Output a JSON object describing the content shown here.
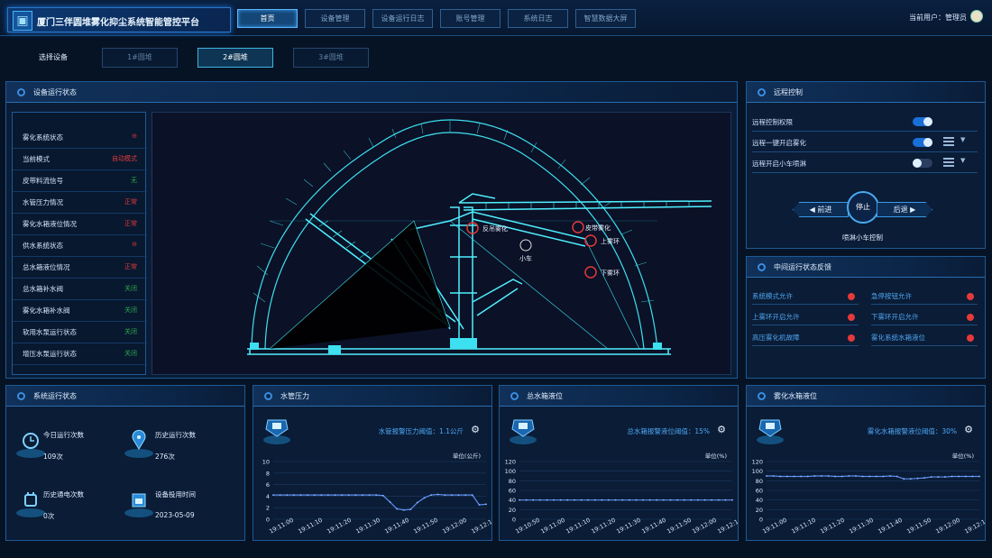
{
  "header": {
    "title": "厦门三伴圆堆雾化抑尘系统智能管控平台",
    "logo_icon": "cube-icon",
    "user_label": "当前用户：管理员",
    "nav": [
      {
        "label": "首页",
        "active": true
      },
      {
        "label": "设备管理"
      },
      {
        "label": "设备运行日志"
      },
      {
        "label": "账号管理"
      },
      {
        "label": "系统日志"
      },
      {
        "label": "智慧数据大屏"
      }
    ]
  },
  "device_select": {
    "label": "选择设备",
    "options": [
      {
        "label": "1#圆堆"
      },
      {
        "label": "2#圆堆",
        "active": true
      },
      {
        "label": "3#圆堆"
      }
    ]
  },
  "device_status": {
    "title": "设备运行状态",
    "rows": [
      {
        "label": "雾化系统状态",
        "value": "⊖",
        "color": "#e33a3a"
      },
      {
        "label": "当前模式",
        "value": "自动模式",
        "color": "#e33a3a"
      },
      {
        "label": "皮带料流信号",
        "value": "无",
        "color": "#2ea84e"
      },
      {
        "label": "水管压力情况",
        "value": "正常",
        "color": "#e33a3a"
      },
      {
        "label": "雾化水箱液位情况",
        "value": "正常",
        "color": "#e33a3a"
      },
      {
        "label": "供水系统状态",
        "value": "⊖",
        "color": "#e33a3a"
      },
      {
        "label": "总水箱液位情况",
        "value": "正常",
        "color": "#e33a3a"
      },
      {
        "label": "总水箱补水阀",
        "value": "关闭",
        "color": "#2ea84e"
      },
      {
        "label": "雾化水箱补水阀",
        "value": "关闭",
        "color": "#2ea84e"
      },
      {
        "label": "软用水泵运行状态",
        "value": "关闭",
        "color": "#2ea84e"
      },
      {
        "label": "增压水泵运行状态",
        "value": "关闭",
        "color": "#2ea84e"
      }
    ],
    "diagram_labels": {
      "left_spray": "反吊雾化",
      "right_spray": "皮带雾化",
      "upper_ring": "上雾环",
      "lower_ring": "下雾环",
      "cart": "小车"
    }
  },
  "remote_control": {
    "title": "远程控制",
    "rows": [
      {
        "label": "远程控制权限",
        "on": true
      },
      {
        "label": "远程一键开启雾化",
        "on": true,
        "menu": true
      },
      {
        "label": "远程开启小车喷淋",
        "on": false,
        "menu": true
      }
    ],
    "forward_label": "前进",
    "stop_label": "停止",
    "back_label": "后退",
    "caption": "喷淋小车控制"
  },
  "feedback": {
    "title": "中间运行状态反馈",
    "items": [
      {
        "label": "系统模式允许"
      },
      {
        "label": "急停按钮允许"
      },
      {
        "label": "上雾环开启允许"
      },
      {
        "label": "下雾环开启允许"
      },
      {
        "label": "高压雾化机故障"
      },
      {
        "label": "雾化系统水箱液位"
      }
    ],
    "dot_color": "#e5393a"
  },
  "system_stats": {
    "title": "系统运行状态",
    "items": [
      {
        "label": "今日运行次数",
        "value": "109次",
        "icon": "clock-icon"
      },
      {
        "label": "历史运行次数",
        "value": "276次",
        "icon": "location-pin-icon"
      },
      {
        "label": "历史通电次数",
        "value": "0次",
        "icon": "power-plug-icon"
      },
      {
        "label": "设备投用时间",
        "value": "2023-05-09",
        "icon": "calendar-icon"
      }
    ]
  },
  "charts": [
    {
      "title": "水管压力",
      "threshold": "水管报警压力阈值：1.1公斤",
      "unit": "单位(公斤)",
      "chart_data": {
        "type": "line",
        "x": [
          "19:11:00",
          "19:11:10",
          "19:11:20",
          "19:11:30",
          "19:11:40",
          "19:11:50",
          "19:12:00",
          "19:12:10"
        ],
        "ylim": [
          0,
          10
        ],
        "yticks": [
          0,
          2,
          4,
          6,
          8,
          10
        ],
        "values": [
          4.2,
          4.2,
          4.2,
          4.2,
          4.2,
          4.2,
          4.2,
          4.2,
          4.2,
          4.2,
          4.2,
          4.2,
          4.2,
          4.2,
          4.2,
          4.2,
          4.1,
          3.0,
          1.8,
          1.6,
          1.7,
          2.9,
          3.7,
          4.2,
          4.3,
          4.2,
          4.2,
          4.2,
          4.2,
          4.2,
          2.5,
          2.6
        ]
      }
    },
    {
      "title": "总水箱液位",
      "threshold": "总水箱报警液位阈值：15%",
      "unit": "单位(%)",
      "chart_data": {
        "type": "line",
        "x": [
          "19:10:50",
          "19:11:00",
          "19:11:10",
          "19:11:20",
          "19:11:30",
          "19:11:40",
          "19:11:50",
          "19:12:00",
          "19:12:10"
        ],
        "ylim": [
          0,
          120
        ],
        "yticks": [
          0,
          20,
          40,
          60,
          80,
          100,
          120
        ],
        "values": [
          40,
          40,
          40,
          40,
          40,
          40,
          40,
          40,
          40,
          40,
          40,
          40,
          40,
          40,
          40,
          40,
          40,
          40,
          40,
          40,
          40,
          40,
          40,
          40,
          40,
          40,
          40,
          40,
          40,
          40,
          40,
          40
        ]
      }
    },
    {
      "title": "雾化水箱液位",
      "threshold": "雾化水箱报警液位阈值：30%",
      "unit": "单位(%)",
      "chart_data": {
        "type": "line",
        "x": [
          "19:11:00",
          "19:11:10",
          "19:11:20",
          "19:11:30",
          "19:11:40",
          "19:11:50",
          "19:12:00",
          "19:12:10"
        ],
        "ylim": [
          0,
          120
        ],
        "yticks": [
          0,
          20,
          40,
          60,
          80,
          100,
          120
        ],
        "values": [
          90,
          90,
          89,
          89,
          89,
          89,
          89,
          90,
          90,
          90,
          89,
          89,
          90,
          90,
          89,
          89,
          89,
          89,
          90,
          89,
          84,
          84,
          85,
          86,
          88,
          88,
          88,
          89,
          89,
          89,
          89,
          89
        ]
      }
    }
  ],
  "colors": {
    "accent": "#3fb5e0",
    "line": "#5b8ff0",
    "alarm": "#e33a3a"
  }
}
